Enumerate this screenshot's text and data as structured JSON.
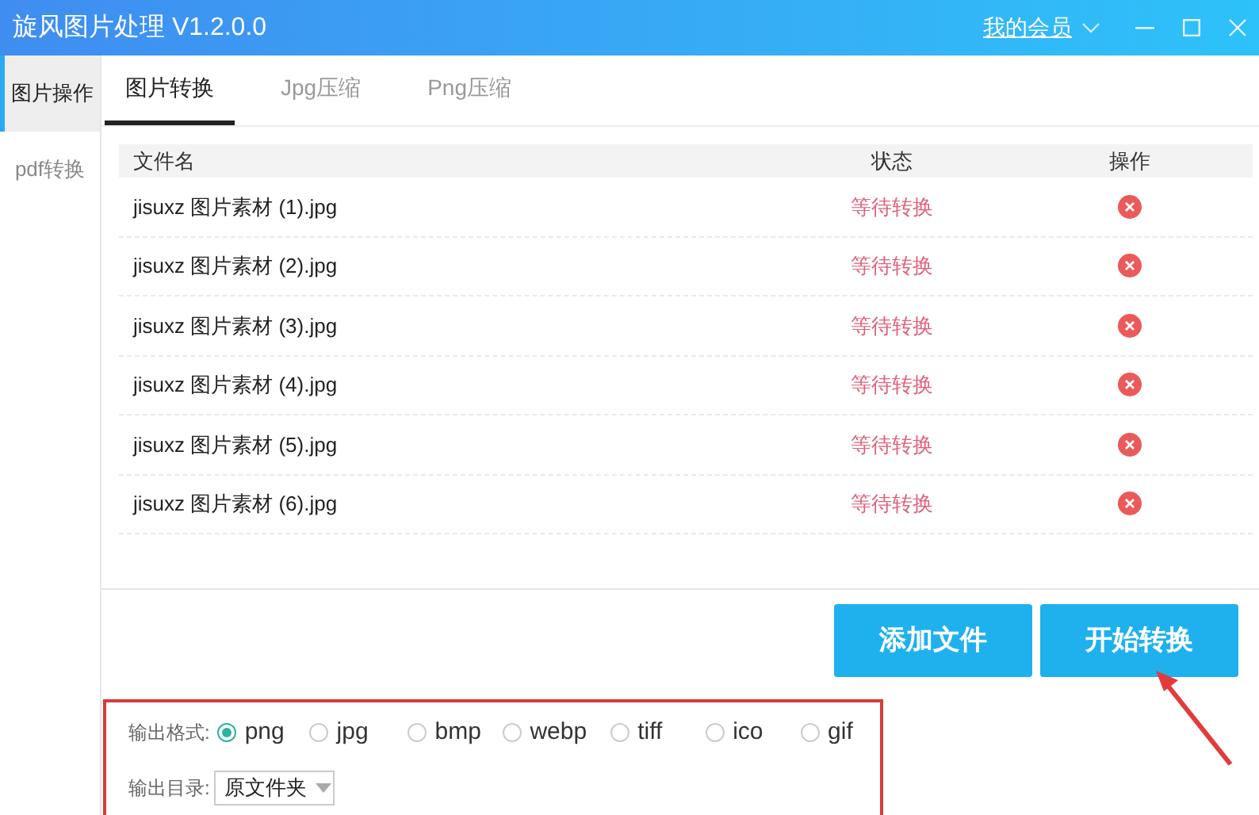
{
  "window": {
    "title": "旋风图片处理 V1.2.0.0",
    "member_link": "我的会员"
  },
  "sidebar": {
    "items": [
      {
        "label": "图片操作",
        "selected": true
      },
      {
        "label": "pdf转换",
        "selected": false
      }
    ]
  },
  "tabs": [
    {
      "label": "图片转换",
      "selected": true
    },
    {
      "label": "Jpg压缩",
      "selected": false
    },
    {
      "label": "Png压缩",
      "selected": false
    }
  ],
  "table": {
    "columns": [
      "文件名",
      "状态",
      "操作"
    ],
    "rows": [
      {
        "name": "jisuxz 图片素材 (1).jpg",
        "status": "等待转换"
      },
      {
        "name": "jisuxz 图片素材 (2).jpg",
        "status": "等待转换"
      },
      {
        "name": "jisuxz 图片素材 (3).jpg",
        "status": "等待转换"
      },
      {
        "name": "jisuxz 图片素材 (4).jpg",
        "status": "等待转换"
      },
      {
        "name": "jisuxz 图片素材 (5).jpg",
        "status": "等待转换"
      },
      {
        "name": "jisuxz 图片素材 (6).jpg",
        "status": "等待转换"
      }
    ]
  },
  "buttons": [
    "添加文件",
    "开始转换"
  ],
  "output_format": {
    "label": "输出格式:",
    "options": [
      {
        "label": "png",
        "selected": true
      },
      {
        "label": "jpg",
        "selected": false
      },
      {
        "label": "bmp",
        "selected": false
      },
      {
        "label": "webp",
        "selected": false
      },
      {
        "label": "tiff",
        "selected": false
      },
      {
        "label": "ico",
        "selected": false
      },
      {
        "label": "gif",
        "selected": false
      }
    ]
  },
  "output_dir": {
    "label": "输出目录:",
    "value": "原文件夹"
  }
}
